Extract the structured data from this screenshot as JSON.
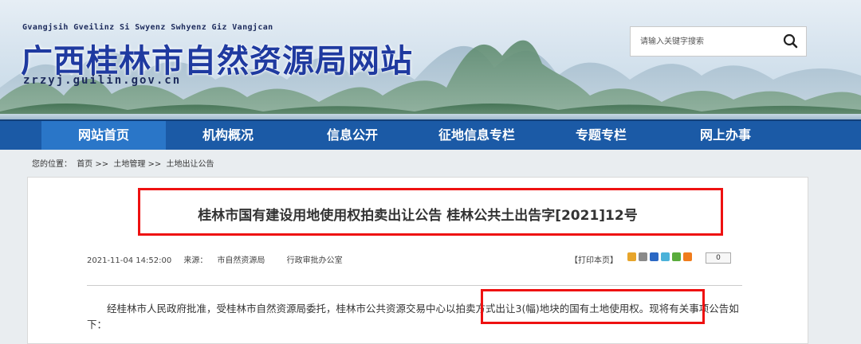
{
  "header": {
    "subtitle": "Gvangjsih Gveilinz Si Swyenz Swhyenz Giz Vangjcan",
    "title": "广西桂林市自然资源局网站",
    "domain": "zrzyj.guilin.gov.cn",
    "search_placeholder": "请输入关键字搜索",
    "search_icon": "search-icon"
  },
  "nav": {
    "items": [
      {
        "label": "网站首页",
        "active": true
      },
      {
        "label": "机构概况"
      },
      {
        "label": "信息公开"
      },
      {
        "label": "征地信息专栏"
      },
      {
        "label": "专题专栏"
      },
      {
        "label": "网上办事"
      }
    ]
  },
  "breadcrumb": {
    "prefix": "您的位置：",
    "items": [
      "首页",
      "土地管理",
      "土地出让公告"
    ],
    "separator": ">>"
  },
  "article": {
    "title": "桂林市国有建设用地使用权拍卖出让公告 桂林公共土出告字[2021]12号",
    "datetime": "2021-11-04 14:52:00",
    "source_label": "来源：",
    "source_value": "市自然资源局",
    "department": "行政审批办公室",
    "print_label": "【打印本页】",
    "share_count": "0",
    "body": "经桂林市人民政府批准，受桂林市自然资源局委托，桂林市公共资源交易中心以拍卖方式出让3(幅)地块的国有土地使用权。现将有关事项公告如下："
  },
  "colors": {
    "nav_bg": "#1b5aa6",
    "nav_active": "#2a76c8",
    "title_blue": "#1f3aa0",
    "highlight_red": "#ee1111"
  }
}
